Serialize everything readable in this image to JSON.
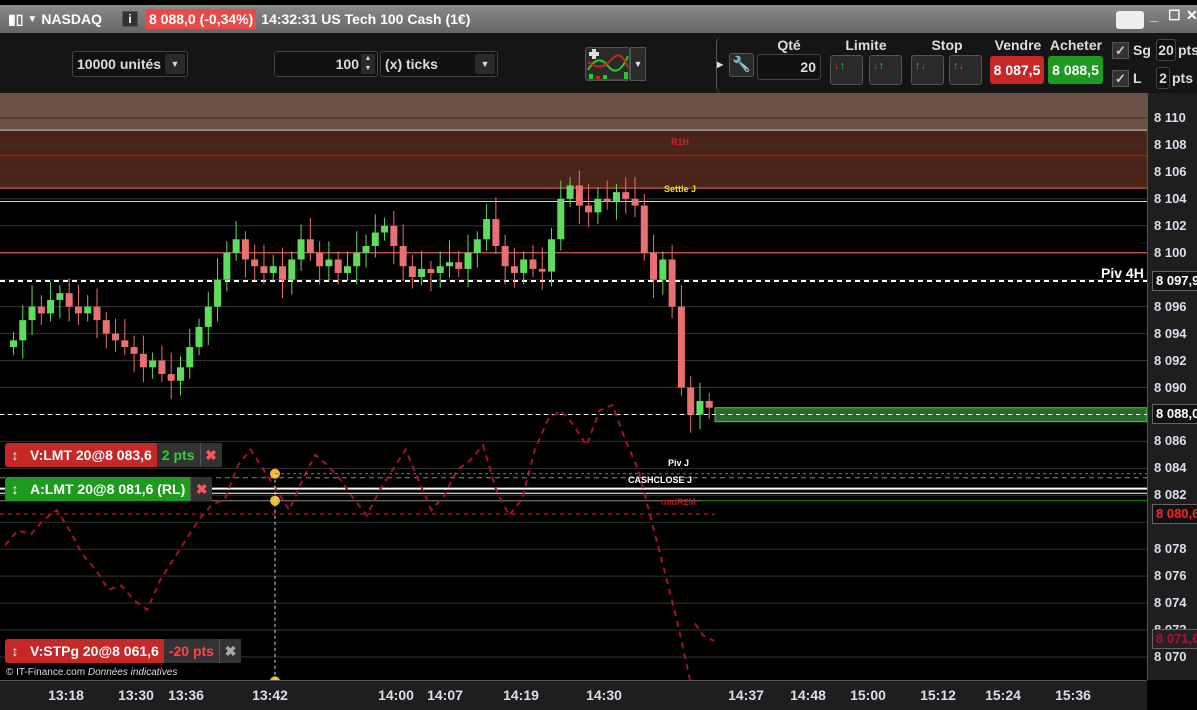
{
  "titlebar": {
    "symbol": "NASDAQ",
    "price_change": "8 088,0 (-0,34%)",
    "info": "14:32:31 US Tech 100 Cash (1€)",
    "info_icon": "i"
  },
  "toolbar": {
    "units": "10000 unités",
    "ticks_value": "100",
    "ticks_unit": "(x) ticks",
    "qty_label": "Qté",
    "qty_value": "20",
    "limit_label": "Limite",
    "stop_label": "Stop",
    "sell_label": "Vendre",
    "buy_label": "Acheter",
    "sell_price": "8 087,5",
    "buy_price": "8 088,5",
    "sg_label": "Sg",
    "sg_value": "20",
    "sg_unit": "pts",
    "l_label": "L",
    "l_value": "2",
    "l_unit": "pts",
    "checkmark": "✓"
  },
  "orders": [
    {
      "text": "V:LMT 20@8 083,6",
      "pts": "2 pts",
      "price": 8083.6
    },
    {
      "text": "A:LMT 20@8 081,6 (RL)",
      "price": 8081.6
    },
    {
      "text": "V:STPg 20@8 061,6",
      "pts": "-20 pts",
      "price": 8061.6
    }
  ],
  "copyright": "© IT-Finance.com",
  "disclaimer": "Données indicatives",
  "colors": {
    "up": "#5ddc5d",
    "down": "#e87070",
    "sell": "#c62828",
    "buy": "#1e9a1e",
    "overlay": "#a0103a"
  },
  "chart_data": {
    "type": "candlestick",
    "ylim": [
      8068,
      8113
    ],
    "yticks": [
      "8 110",
      "8 108",
      "8 106",
      "8 104",
      "8 102",
      "8 100",
      "8 096",
      "8 094",
      "8 092",
      "8 090",
      "8 086",
      "8 084",
      "8 082",
      "8 078",
      "8 076",
      "8 074",
      "8 072",
      "8 070"
    ],
    "ytick_values": [
      8110,
      8108,
      8106,
      8104,
      8102,
      8100,
      8096,
      8094,
      8092,
      8090,
      8086,
      8084,
      8082,
      8078,
      8076,
      8074,
      8072,
      8070
    ],
    "xticks": [
      "13:18",
      "13:30",
      "13:36",
      "13:42",
      "14:00",
      "14:07",
      "14:19",
      "14:30",
      "14:37",
      "14:48",
      "15:00",
      "15:12",
      "15:24",
      "15:36"
    ],
    "closes": [
      8093.5,
      8095,
      8096,
      8095.5,
      8096.5,
      8097,
      8096,
      8095.5,
      8096,
      8095,
      8094,
      8093.5,
      8093,
      8092.5,
      8091.5,
      8092,
      8091,
      8090.5,
      8091.5,
      8093,
      8094.5,
      8096,
      8098,
      8100,
      8101,
      8099.5,
      8099,
      8098.5,
      8099,
      8098,
      8099.5,
      8101,
      8100,
      8099,
      8099.5,
      8098.5,
      8099,
      8100,
      8100.5,
      8101.5,
      8102,
      8100.5,
      8099,
      8098.2,
      8098.8,
      8098.5,
      8099,
      8099.3,
      8098.8,
      8100,
      8101,
      8102.5,
      8100.5,
      8099,
      8098.5,
      8099.5,
      8098.8,
      8098.6,
      8101,
      8104,
      8105,
      8103.5,
      8103,
      8104,
      8103.8,
      8104.5,
      8104,
      8103.5,
      8100,
      8098,
      8099.5,
      8096,
      8090,
      8088,
      8089,
      8088.5
    ],
    "overlay_line": [
      8078.3,
      8079.4,
      8079.1,
      8080.2,
      8080.9,
      8079.4,
      8077.6,
      8076.5,
      8075.0,
      8075.3,
      8074.2,
      8073.5,
      8075.7,
      8077.2,
      8078.7,
      8080.2,
      8081.3,
      8081.7,
      8084.2,
      8085.4,
      8083.9,
      8082.4,
      8080.9,
      8083.1,
      8085.0,
      8084.2,
      8083.1,
      8081.7,
      8080.5,
      8082.4,
      8083.9,
      8085.4,
      8083.1,
      8080.9,
      8082.0,
      8083.9,
      8084.6,
      8085.7,
      8082.4,
      8080.5,
      8081.7,
      8085.4,
      8087.6,
      8088.3,
      8087.2,
      8085.7,
      8088.3,
      8088.7,
      8086.1,
      8083.9,
      8080.2,
      8076.5,
      8072.7,
      8068.3
    ],
    "levels": [
      {
        "name": "R1H",
        "price": 8107.2
      },
      {
        "name": "Settle J",
        "price": 8104.6
      },
      {
        "name": "Piv 4H",
        "price": 8097.9,
        "tag": "8 097,9"
      },
      {
        "name": "Piv J",
        "price": 8083.3
      },
      {
        "name": "CASHCLOSE J",
        "price": 8082.9
      },
      {
        "name": "midR2M",
        "price": 8081.6
      }
    ],
    "last_price_tag": "8 088,0",
    "red_tag": "8 080,6",
    "maroon_tag": "8 071,6"
  }
}
